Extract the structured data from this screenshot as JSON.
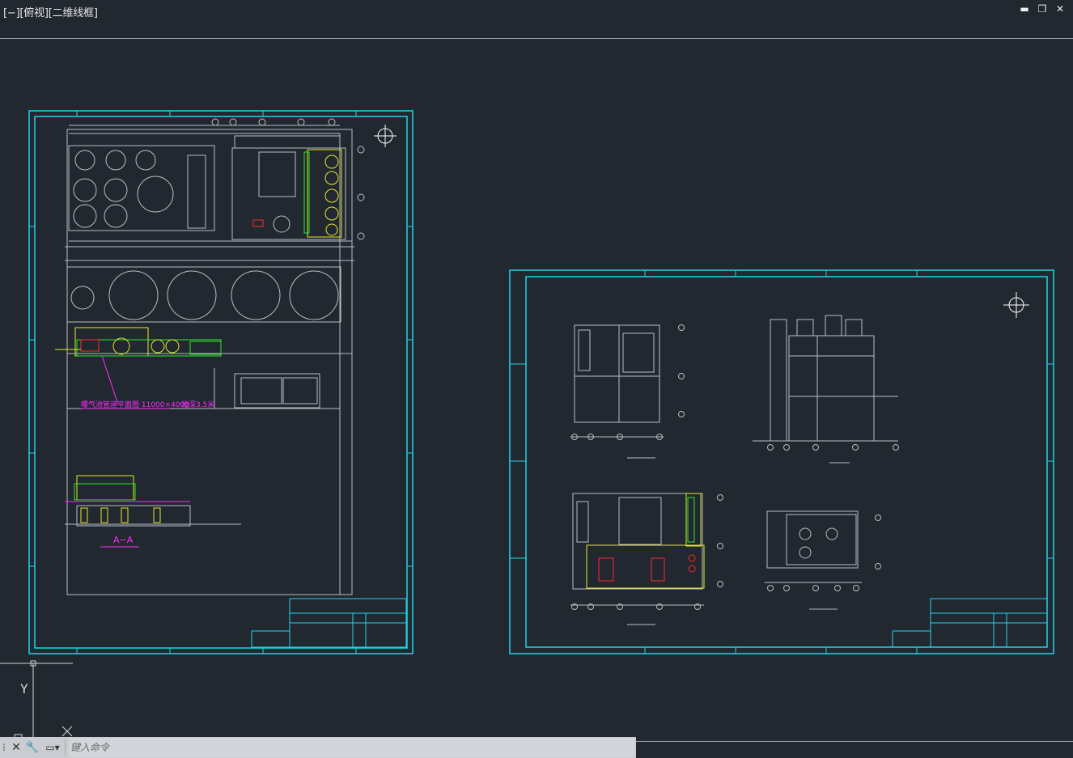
{
  "viewport": {
    "label": "[−][俯视][二维线框]"
  },
  "window_controls": {
    "minimize": "▬",
    "restore": "❐",
    "close": "✕"
  },
  "ucs": {
    "y_label": "Y",
    "x_marker": "✕"
  },
  "sheet1": {
    "annotation": "曝气池管道平面图 11000×4000",
    "annotation2": "池深3.5米",
    "section_label": "A−A"
  },
  "sheet2": {
    "compass": "⊕"
  },
  "command": {
    "placeholder": "键入命令",
    "close_icon": "✕",
    "wrench_icon": "🔧",
    "prompt_icon": "▭▾"
  },
  "colors": {
    "background": "#212830",
    "frame": "#22d3e6",
    "linework": "#b8bec4",
    "yellow": "#e8e82a",
    "green": "#2ee82e",
    "magenta": "#ff2bff",
    "red": "#ff2a2a"
  }
}
